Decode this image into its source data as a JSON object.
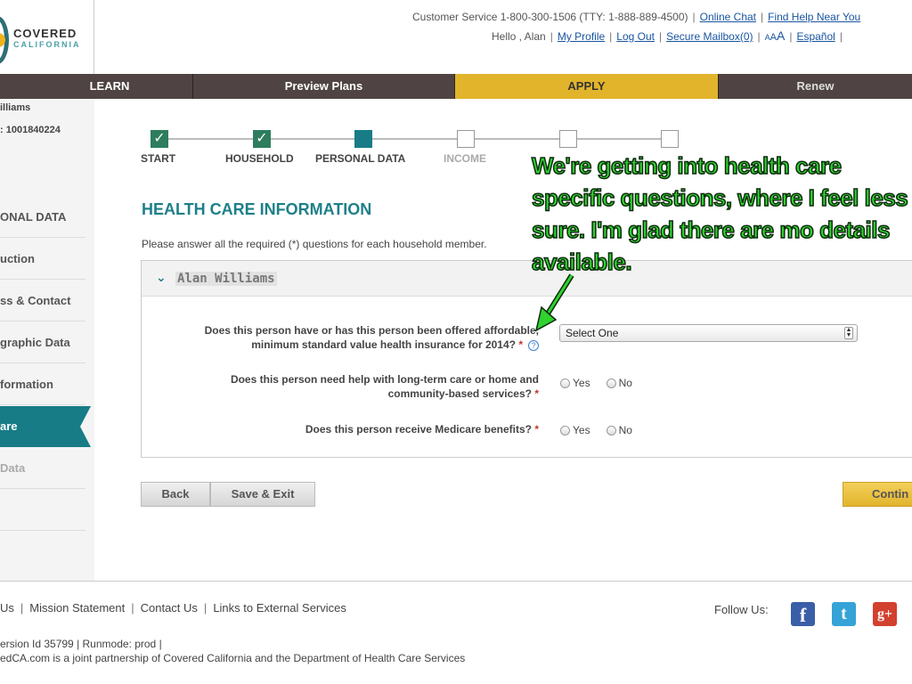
{
  "header": {
    "logo_line1": "COVERED",
    "logo_line2": "CALIFORNIA",
    "customer_service": "Customer Service 1-800-300-1506 (TTY: 1-888-889-4500)",
    "online_chat": "Online Chat",
    "find_help": "Find Help Near You",
    "greeting": "Hello , Alan",
    "my_profile": "My Profile",
    "log_out": "Log Out",
    "secure_mailbox": "Secure Mailbox(0)",
    "text_size_small": "A",
    "text_size_medium": "A",
    "text_size_large": "A",
    "espanol": "Español"
  },
  "nav": {
    "learn": "LEARN",
    "preview_plans": "Preview Plans",
    "apply": "APPLY",
    "renew": "Renew"
  },
  "sidebar": {
    "name": "illiams",
    "case_id": ": 1001840224",
    "items": [
      {
        "label": "ONAL DATA"
      },
      {
        "label": "uction"
      },
      {
        "label": "ss & Contact"
      },
      {
        "label": "graphic Data"
      },
      {
        "label": "formation"
      },
      {
        "label": "are"
      },
      {
        "label": "Data"
      }
    ]
  },
  "stepper": {
    "steps": [
      {
        "label": "START",
        "state": "done"
      },
      {
        "label": "HOUSEHOLD",
        "state": "done"
      },
      {
        "label": "PERSONAL DATA",
        "state": "current"
      },
      {
        "label": "INCOME",
        "state": "future"
      },
      {
        "label": "",
        "state": "future"
      },
      {
        "label": "",
        "state": "future"
      }
    ]
  },
  "main": {
    "section_title": "HEALTH CARE INFORMATION",
    "instructions": "Please answer all the required (*) questions for each household member.",
    "member_name": "Alan  Williams",
    "questions": [
      {
        "text": "Does this person have or has this person been offered affordable, minimum standard value health insurance for 2014?",
        "required": "*",
        "help": "?",
        "control": "select",
        "value": "Select One"
      },
      {
        "text": "Does this person need help with long-term care or home and community-based services?",
        "required": "*",
        "control": "radio",
        "options": [
          "Yes",
          "No"
        ]
      },
      {
        "text": "Does this person receive Medicare benefits?",
        "required": "*",
        "control": "radio",
        "options": [
          "Yes",
          "No"
        ]
      }
    ],
    "buttons": {
      "back": "Back",
      "save_exit": "Save & Exit",
      "continue": "Contin"
    }
  },
  "annotation": {
    "text": "We're getting into health care specific questions, where I feel less sure. I'm glad there are mo details available.",
    "color": "#2fd22f"
  },
  "footer": {
    "links": [
      "Us",
      "Mission Statement",
      "Contact Us",
      "Links to External Services"
    ],
    "follow_us": "Follow Us:",
    "social": [
      {
        "name": "facebook-icon",
        "glyph": "f"
      },
      {
        "name": "twitter-icon",
        "glyph": "t"
      },
      {
        "name": "google-plus-icon",
        "glyph": "g+"
      }
    ],
    "version": "ersion Id 35799  |   Runmode: prod  |",
    "copyright": "edCA.com is a joint partnership of Covered California and the Department of Health Care Services"
  },
  "colors": {
    "teal": "#177c86",
    "apply_gold": "#e2b42c",
    "nav_dark": "#4f4443",
    "link_blue": "#1a55a0",
    "required_red": "#c0392b"
  }
}
